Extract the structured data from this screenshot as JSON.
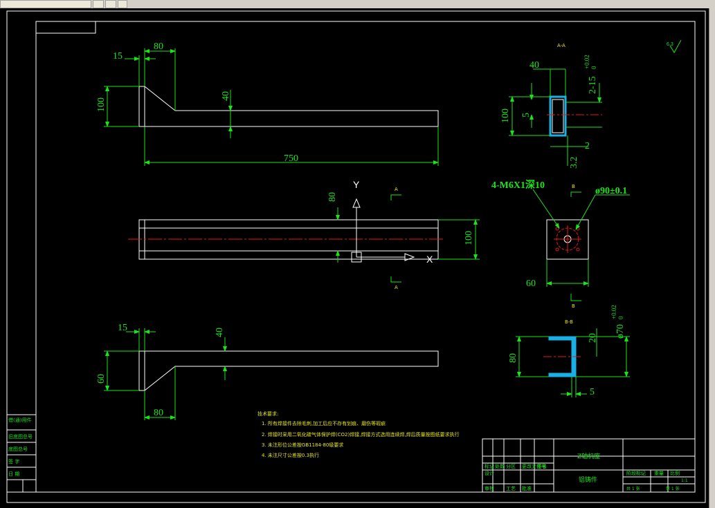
{
  "colors": {
    "background": "#000000",
    "geometry": "#ffffff",
    "dimension": "#19e619",
    "centerline": "#e61919",
    "hatch": "#19b0e6",
    "notes": "#e6e619"
  },
  "front_view": {
    "dims": {
      "top_width": "80",
      "lip": "15",
      "height": "100",
      "thickness": "40",
      "length": "750"
    }
  },
  "plan_view": {
    "dims": {
      "offset": "80",
      "width": "100"
    },
    "axis_y": "Y",
    "axis_x": "X",
    "section_mark": "A"
  },
  "bottom_view": {
    "dims": {
      "lip": "15",
      "thickness": "40",
      "height": "60",
      "bottom_width": "80"
    }
  },
  "section_aa": {
    "title": "A-A",
    "dims": {
      "depth": "40",
      "tol_slot": "2-15",
      "tol_upper": "+0.02",
      "tol_lower": "0",
      "height": "100",
      "inner": "5",
      "wall": "2"
    },
    "roughness": "3.2"
  },
  "end_view": {
    "holes": "4-M6X1深10",
    "bolt_circle": "ø90±0.1",
    "offset": "60",
    "section_mark": "B"
  },
  "section_bb": {
    "title": "B-B",
    "dims": {
      "height": "80",
      "depth": "20",
      "diameter": "ø70",
      "tol_upper": "+0.02",
      "tol_lower": "0",
      "wall": "5"
    }
  },
  "corner_roughness": {
    "value": "6.3"
  },
  "notes": {
    "title": "技术要求:",
    "items": [
      "1. 所有焊接件去除毛刺,加工后应不存有划痕、磨伤等瑕疵",
      "2. 焊接时采用二氧化碳气体保护焊(CO2)焊接,焊接方式选用连续焊,焊后质量按图纸要求执行",
      "3. 未注形位公差按GB1184-80级要求",
      "4. 未注尺寸公差按0.3执行"
    ]
  },
  "title_block": {
    "part_name": "Z轴机座",
    "material": "铝铸件",
    "scale": "1:1",
    "sheet": "第 1 张",
    "sheets": "共 1 张",
    "labels": [
      "标记",
      "处数",
      "分区",
      "更改文件号",
      "签名",
      "年月日",
      "设计",
      "审核",
      "工艺",
      "批准",
      "阶段标记",
      "重量",
      "比例"
    ]
  },
  "side_strip": {
    "labels": [
      "借(通)用件",
      "旧底图总号",
      "底图总号",
      "签 字",
      "日 期"
    ]
  }
}
